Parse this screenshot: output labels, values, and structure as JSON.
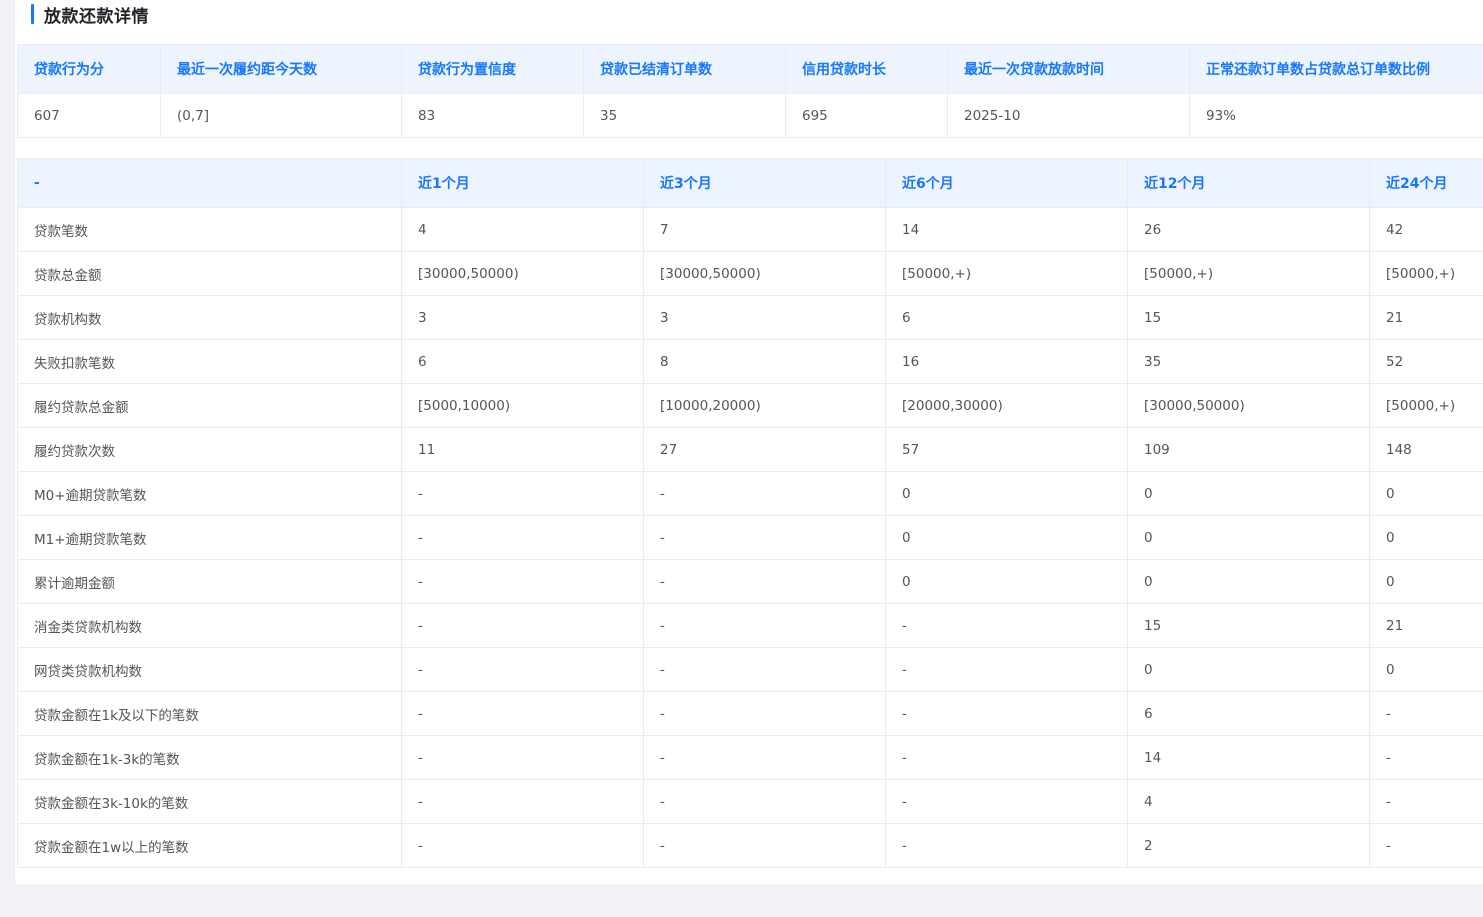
{
  "section": {
    "title": "放款还款详情"
  },
  "summary": {
    "headers": [
      "贷款行为分",
      "最近一次履约距今天数",
      "贷款行为置信度",
      "贷款已结清订单数",
      "信用贷款时长",
      "最近一次贷款放款时间",
      "正常还款订单数占贷款总订单数比例"
    ],
    "values": [
      "607",
      "(0,7]",
      "83",
      "35",
      "695",
      "2025-10",
      "93%"
    ]
  },
  "periods": {
    "headers": [
      "-",
      "近1个月",
      "近3个月",
      "近6个月",
      "近12个月",
      "近24个月"
    ],
    "rows": [
      [
        "贷款笔数",
        "4",
        "7",
        "14",
        "26",
        "42"
      ],
      [
        "贷款总金额",
        "[30000,50000)",
        "[30000,50000)",
        "[50000,+)",
        "[50000,+)",
        "[50000,+)"
      ],
      [
        "贷款机构数",
        "3",
        "3",
        "6",
        "15",
        "21"
      ],
      [
        "失败扣款笔数",
        "6",
        "8",
        "16",
        "35",
        "52"
      ],
      [
        "履约贷款总金额",
        "[5000,10000)",
        "[10000,20000)",
        "[20000,30000)",
        "[30000,50000)",
        "[50000,+)"
      ],
      [
        "履约贷款次数",
        "11",
        "27",
        "57",
        "109",
        "148"
      ],
      [
        "M0+逾期贷款笔数",
        "-",
        "-",
        "0",
        "0",
        "0"
      ],
      [
        "M1+逾期贷款笔数",
        "-",
        "-",
        "0",
        "0",
        "0"
      ],
      [
        "累计逾期金额",
        "-",
        "-",
        "0",
        "0",
        "0"
      ],
      [
        "消金类贷款机构数",
        "-",
        "-",
        "-",
        "15",
        "21"
      ],
      [
        "网贷类贷款机构数",
        "-",
        "-",
        "-",
        "0",
        "0"
      ],
      [
        "贷款金额在1k及以下的笔数",
        "-",
        "-",
        "-",
        "6",
        "-"
      ],
      [
        "贷款金额在1k-3k的笔数",
        "-",
        "-",
        "-",
        "14",
        "-"
      ],
      [
        "贷款金额在3k-10k的笔数",
        "-",
        "-",
        "-",
        "4",
        "-"
      ],
      [
        "贷款金额在1w以上的笔数",
        "-",
        "-",
        "-",
        "2",
        "-"
      ]
    ]
  },
  "colors": {
    "accent": "#1677ff",
    "header_bg": "#eef4fd",
    "border": "#e6ecf5",
    "page_bg": "#f0f2f5"
  }
}
